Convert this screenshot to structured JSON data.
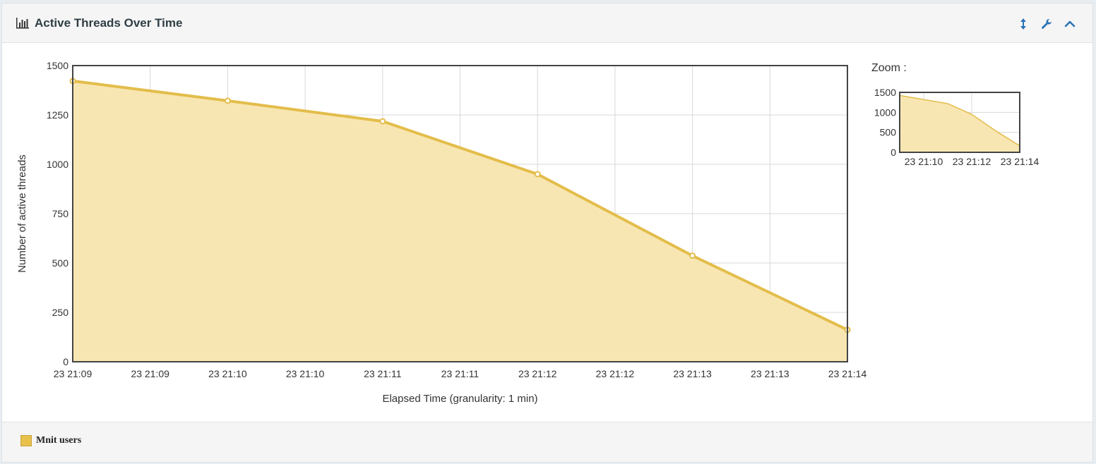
{
  "header": {
    "title": "Active Threads Over Time",
    "icons": [
      "bar-chart-icon",
      "resize-vertical-icon",
      "wrench-icon",
      "chevron-up-icon"
    ]
  },
  "colors": {
    "line": "#e3bd4b",
    "fill": "#f8e6b2",
    "frame": "#444444",
    "grid": "#d8d8d8",
    "header_icon": "#2b73b6"
  },
  "chart_data": [
    {
      "type": "area",
      "title": "",
      "xlabel": "Elapsed Time (granularity: 1 min)",
      "ylabel": "Number of active threads",
      "x_ticks": [
        "23 21:09",
        "23 21:09",
        "23 21:10",
        "23 21:10",
        "23 21:11",
        "23 21:11",
        "23 21:12",
        "23 21:12",
        "23 21:13",
        "23 21:13",
        "23 21:14"
      ],
      "y_ticks": [
        0,
        250,
        500,
        750,
        1000,
        1250,
        1500
      ],
      "xlim_minutes": [
        0,
        5
      ],
      "ylim": [
        0,
        1500
      ],
      "grid": true,
      "series": [
        {
          "name": "Mnit users",
          "x_labels": [
            "23 21:09",
            "23 21:10",
            "23 21:11",
            "23 21:12",
            "23 21:13",
            "23 21:14"
          ],
          "x_minutes": [
            0,
            1,
            2,
            3,
            4,
            5
          ],
          "values": [
            1422,
            1322,
            1218,
            950,
            537,
            162
          ]
        }
      ]
    },
    {
      "type": "area",
      "title": "Zoom :",
      "x_ticks": [
        "23 21:10",
        "23 21:12",
        "23 21:14"
      ],
      "y_ticks": [
        0,
        500,
        1000,
        1500
      ],
      "ylim": [
        0,
        1500
      ],
      "grid": true
    }
  ],
  "legend": {
    "items": [
      {
        "label": "Mnit users",
        "color": "#e8c04c"
      }
    ]
  }
}
